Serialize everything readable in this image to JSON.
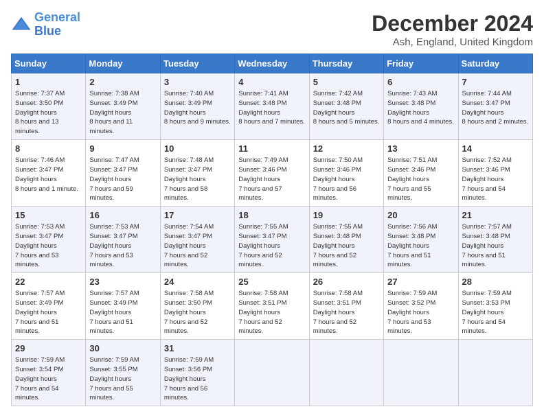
{
  "logo": {
    "line1": "General",
    "line2": "Blue"
  },
  "title": "December 2024",
  "subtitle": "Ash, England, United Kingdom",
  "headers": [
    "Sunday",
    "Monday",
    "Tuesday",
    "Wednesday",
    "Thursday",
    "Friday",
    "Saturday"
  ],
  "weeks": [
    [
      {
        "day": "1",
        "sunrise": "7:37 AM",
        "sunset": "3:50 PM",
        "daylight": "8 hours and 13 minutes."
      },
      {
        "day": "2",
        "sunrise": "7:38 AM",
        "sunset": "3:49 PM",
        "daylight": "8 hours and 11 minutes."
      },
      {
        "day": "3",
        "sunrise": "7:40 AM",
        "sunset": "3:49 PM",
        "daylight": "8 hours and 9 minutes."
      },
      {
        "day": "4",
        "sunrise": "7:41 AM",
        "sunset": "3:48 PM",
        "daylight": "8 hours and 7 minutes."
      },
      {
        "day": "5",
        "sunrise": "7:42 AM",
        "sunset": "3:48 PM",
        "daylight": "8 hours and 5 minutes."
      },
      {
        "day": "6",
        "sunrise": "7:43 AM",
        "sunset": "3:48 PM",
        "daylight": "8 hours and 4 minutes."
      },
      {
        "day": "7",
        "sunrise": "7:44 AM",
        "sunset": "3:47 PM",
        "daylight": "8 hours and 2 minutes."
      }
    ],
    [
      {
        "day": "8",
        "sunrise": "7:46 AM",
        "sunset": "3:47 PM",
        "daylight": "8 hours and 1 minute."
      },
      {
        "day": "9",
        "sunrise": "7:47 AM",
        "sunset": "3:47 PM",
        "daylight": "7 hours and 59 minutes."
      },
      {
        "day": "10",
        "sunrise": "7:48 AM",
        "sunset": "3:47 PM",
        "daylight": "7 hours and 58 minutes."
      },
      {
        "day": "11",
        "sunrise": "7:49 AM",
        "sunset": "3:46 PM",
        "daylight": "7 hours and 57 minutes."
      },
      {
        "day": "12",
        "sunrise": "7:50 AM",
        "sunset": "3:46 PM",
        "daylight": "7 hours and 56 minutes."
      },
      {
        "day": "13",
        "sunrise": "7:51 AM",
        "sunset": "3:46 PM",
        "daylight": "7 hours and 55 minutes."
      },
      {
        "day": "14",
        "sunrise": "7:52 AM",
        "sunset": "3:46 PM",
        "daylight": "7 hours and 54 minutes."
      }
    ],
    [
      {
        "day": "15",
        "sunrise": "7:53 AM",
        "sunset": "3:47 PM",
        "daylight": "7 hours and 53 minutes."
      },
      {
        "day": "16",
        "sunrise": "7:53 AM",
        "sunset": "3:47 PM",
        "daylight": "7 hours and 53 minutes."
      },
      {
        "day": "17",
        "sunrise": "7:54 AM",
        "sunset": "3:47 PM",
        "daylight": "7 hours and 52 minutes."
      },
      {
        "day": "18",
        "sunrise": "7:55 AM",
        "sunset": "3:47 PM",
        "daylight": "7 hours and 52 minutes."
      },
      {
        "day": "19",
        "sunrise": "7:55 AM",
        "sunset": "3:48 PM",
        "daylight": "7 hours and 52 minutes."
      },
      {
        "day": "20",
        "sunrise": "7:56 AM",
        "sunset": "3:48 PM",
        "daylight": "7 hours and 51 minutes."
      },
      {
        "day": "21",
        "sunrise": "7:57 AM",
        "sunset": "3:48 PM",
        "daylight": "7 hours and 51 minutes."
      }
    ],
    [
      {
        "day": "22",
        "sunrise": "7:57 AM",
        "sunset": "3:49 PM",
        "daylight": "7 hours and 51 minutes."
      },
      {
        "day": "23",
        "sunrise": "7:57 AM",
        "sunset": "3:49 PM",
        "daylight": "7 hours and 51 minutes."
      },
      {
        "day": "24",
        "sunrise": "7:58 AM",
        "sunset": "3:50 PM",
        "daylight": "7 hours and 52 minutes."
      },
      {
        "day": "25",
        "sunrise": "7:58 AM",
        "sunset": "3:51 PM",
        "daylight": "7 hours and 52 minutes."
      },
      {
        "day": "26",
        "sunrise": "7:58 AM",
        "sunset": "3:51 PM",
        "daylight": "7 hours and 52 minutes."
      },
      {
        "day": "27",
        "sunrise": "7:59 AM",
        "sunset": "3:52 PM",
        "daylight": "7 hours and 53 minutes."
      },
      {
        "day": "28",
        "sunrise": "7:59 AM",
        "sunset": "3:53 PM",
        "daylight": "7 hours and 54 minutes."
      }
    ],
    [
      {
        "day": "29",
        "sunrise": "7:59 AM",
        "sunset": "3:54 PM",
        "daylight": "7 hours and 54 minutes."
      },
      {
        "day": "30",
        "sunrise": "7:59 AM",
        "sunset": "3:55 PM",
        "daylight": "7 hours and 55 minutes."
      },
      {
        "day": "31",
        "sunrise": "7:59 AM",
        "sunset": "3:56 PM",
        "daylight": "7 hours and 56 minutes."
      },
      null,
      null,
      null,
      null
    ]
  ]
}
